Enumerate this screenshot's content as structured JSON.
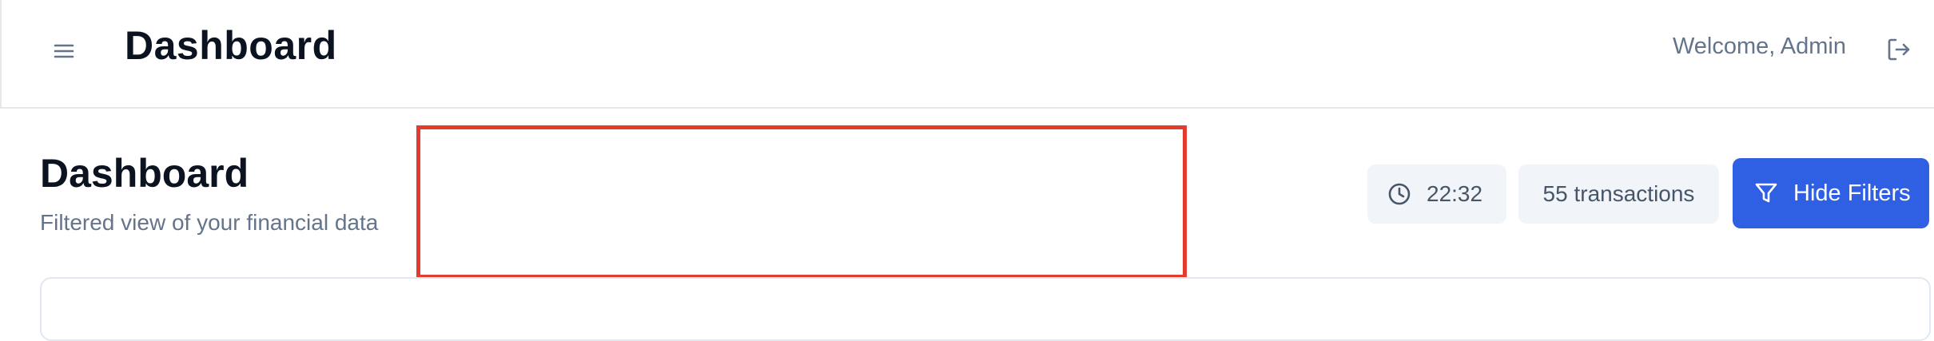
{
  "header": {
    "app_title": "Dashboard",
    "welcome_text": "Welcome, Admin",
    "menu_icon": "hamburger-icon",
    "logout_icon": "logout-icon"
  },
  "page": {
    "title": "Dashboard",
    "subtitle": "Filtered view of your financial data"
  },
  "toolbar": {
    "time": "22:32",
    "time_icon": "clock-icon",
    "transactions": "55 transactions",
    "filter_button_label": "Hide Filters",
    "filter_icon": "filter-icon"
  },
  "colors": {
    "accent": "#2f5fe3",
    "highlight": "#e33b2e",
    "muted_text": "#64748b",
    "chip_bg": "#f1f5f9"
  }
}
